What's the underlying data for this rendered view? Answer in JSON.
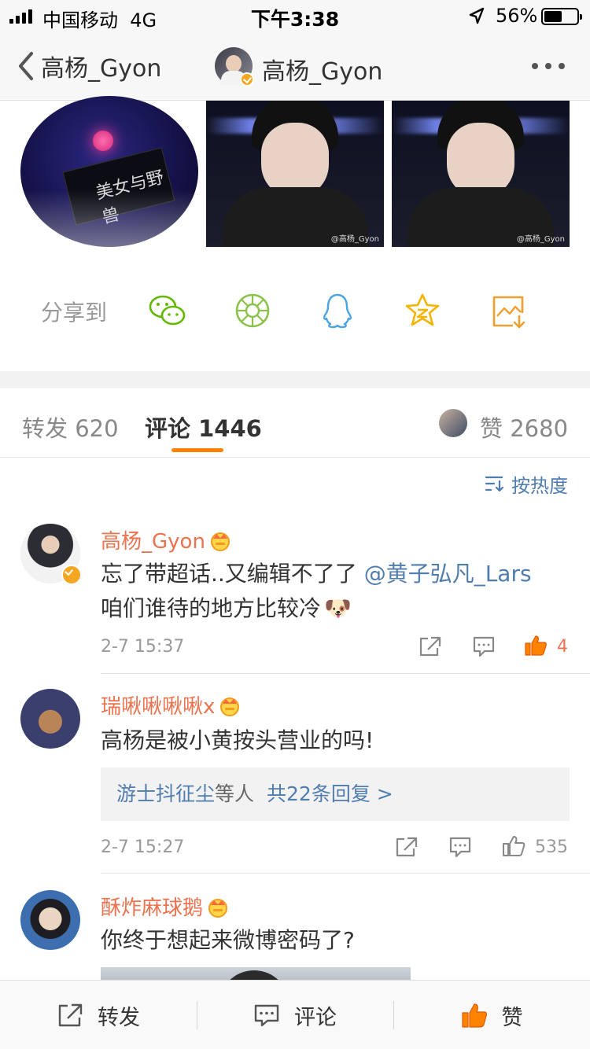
{
  "status_bar": {
    "carrier": "中国移动",
    "network": "4G",
    "time": "下午3:38",
    "battery": "56%"
  },
  "nav": {
    "back_label": "高杨_Gyon",
    "title": "高杨_Gyon"
  },
  "images": {
    "book_text": "美女与野兽",
    "watermark_2": "@高杨_Gyon",
    "watermark_3": "@高杨_Gyon"
  },
  "share": {
    "label": "分享到",
    "targets": [
      "wechat-icon",
      "moments-icon",
      "qq-icon",
      "qzone-icon",
      "save-image-icon"
    ]
  },
  "tabs": {
    "repost": "转发 620",
    "comment": "评论 1446",
    "like": "赞 2680"
  },
  "sort": {
    "label": "按热度"
  },
  "comments": [
    {
      "name": "高杨_Gyon",
      "text_line1_a": "忘了带超话..又编辑不了了 ",
      "text_line1_mention": "@黄子弘凡_Lars",
      "text_line2": "咱们谁待的地方比较冷",
      "emoji": "🐶",
      "time": "2-7 15:37",
      "likes": "4"
    },
    {
      "name": "瑞啾啾啾啾x",
      "text": "高杨是被小黄按头营业的吗!",
      "reply_who": "游士抖征尘",
      "reply_mid": "等人",
      "reply_more": "共22条回复 >",
      "time": "2-7 15:27",
      "likes": "535"
    },
    {
      "name": "酥炸麻球鹅",
      "text": "你终于想起来微博密码了?"
    }
  ],
  "toolbar": {
    "repost": "转发",
    "comment": "评论",
    "like": "赞"
  },
  "colors": {
    "orange": "#ff8200",
    "name_orange": "#eb7350",
    "link_blue": "#507daf",
    "grey_text": "#999999"
  }
}
